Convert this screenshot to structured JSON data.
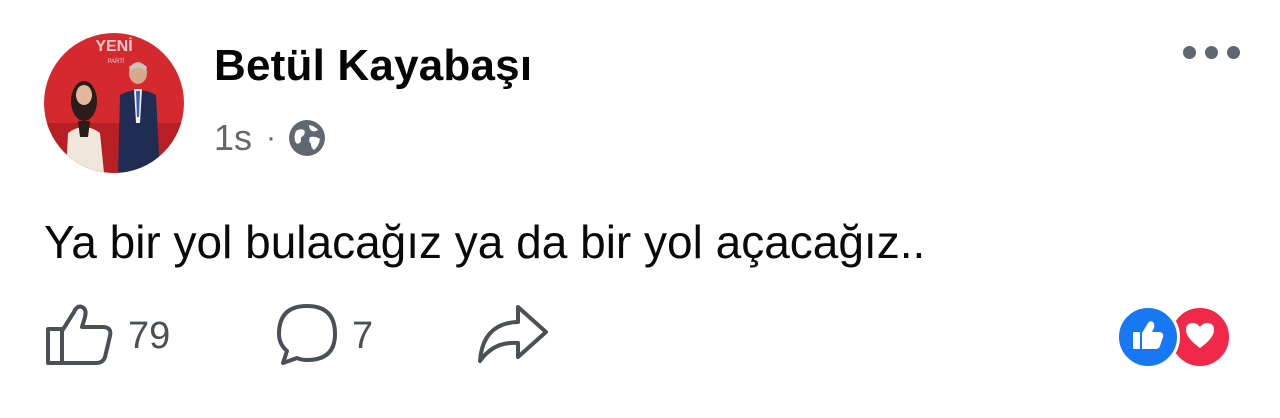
{
  "post": {
    "author_name": "Betül Kayabaşı",
    "timestamp": "1s",
    "separator": "·",
    "privacy_icon": "globe-icon",
    "avatar_badge_text": "YENİ",
    "avatar_badge_subtext": "PARTİ",
    "message": "Ya bir yol bulacağız ya da bir yol açacağız..",
    "menu_icon": "more-options-icon"
  },
  "actions": {
    "like_count": "79",
    "comment_count": "7",
    "like_icon": "thumbs-up-icon",
    "comment_icon": "comment-icon",
    "share_icon": "share-icon"
  },
  "reactions": [
    {
      "type": "like",
      "icon": "thumbs-up-icon",
      "color": "#1877f2"
    },
    {
      "type": "love",
      "icon": "heart-icon",
      "color": "#f0284a"
    }
  ],
  "colors": {
    "text": "#050505",
    "secondary_text": "#65676b",
    "avatar_background": "#d42a2f"
  }
}
